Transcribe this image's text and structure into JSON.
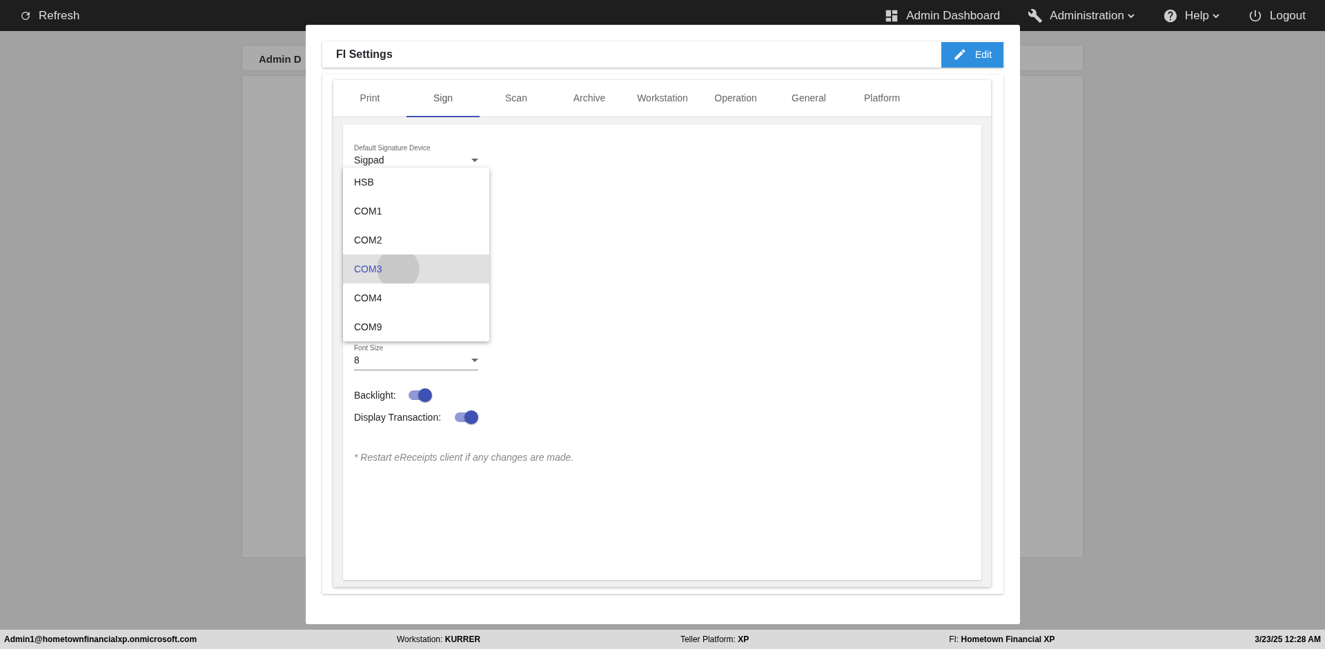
{
  "navbar": {
    "refresh": "Refresh",
    "links": [
      {
        "label": "Admin Dashboard",
        "dropdown": false
      },
      {
        "label": "Administration",
        "dropdown": true
      },
      {
        "label": "Help",
        "dropdown": true
      },
      {
        "label": "Logout",
        "dropdown": false
      }
    ]
  },
  "background_page": {
    "card_title": "Admin D"
  },
  "modal": {
    "title": "FI Settings",
    "edit_button": "Edit",
    "tabs": [
      {
        "label": "Print",
        "selected": false
      },
      {
        "label": "Sign",
        "selected": true
      },
      {
        "label": "Scan",
        "selected": false
      },
      {
        "label": "Archive",
        "selected": false
      },
      {
        "label": "Workstation",
        "selected": false
      },
      {
        "label": "Operation",
        "selected": false
      },
      {
        "label": "General",
        "selected": false
      },
      {
        "label": "Platform",
        "selected": false
      }
    ],
    "fields": [
      {
        "label": "Default Signature Device",
        "value": "Sigpad"
      },
      {
        "label": "Font Size",
        "value": "8"
      }
    ],
    "dropdown": {
      "options": [
        {
          "label": "HSB",
          "selected": false
        },
        {
          "label": "COM1",
          "selected": false
        },
        {
          "label": "COM2",
          "selected": false
        },
        {
          "label": "COM3",
          "selected": true
        },
        {
          "label": "COM4",
          "selected": false
        },
        {
          "label": "COM9",
          "selected": false
        }
      ]
    },
    "toggles": [
      {
        "label": "Backlight:",
        "on": true
      },
      {
        "label": "Display Transaction:",
        "on": true
      }
    ],
    "note": "* Restart eReceipts client if any changes are made."
  },
  "status_bar": {
    "user": "Admin1@hometownfinancialxp.onmicrosoft.com",
    "items": [
      "Workstation: **KURRER**",
      "Teller Platform: **XP**",
      "FI: **Hometown Financial XP**"
    ],
    "datetime": "3/23/25 12:28 AM"
  }
}
